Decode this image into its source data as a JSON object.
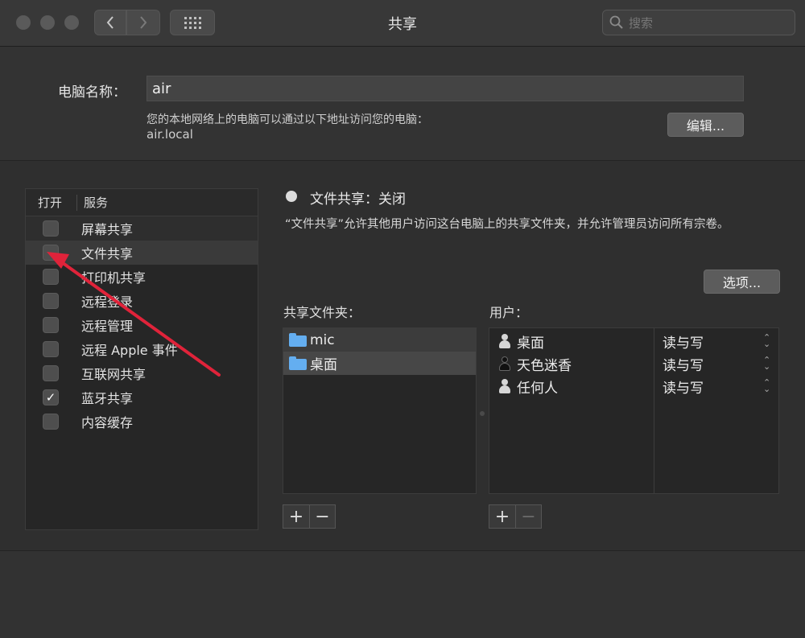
{
  "window": {
    "title": "共享",
    "search_placeholder": "搜索",
    "nav_icons": [
      "back-chevron-icon",
      "forward-chevron-icon",
      "grid-icon"
    ]
  },
  "computer_name": {
    "label": "电脑名称：",
    "value": "air",
    "description": "您的本地网络上的电脑可以通过以下地址访问您的电脑：",
    "local_address": "air.local",
    "edit_button": "编辑..."
  },
  "services": {
    "header_on": "打开",
    "header_service": "服务",
    "items": [
      {
        "label": "屏幕共享",
        "checked": false
      },
      {
        "label": "文件共享",
        "checked": false,
        "selected": true
      },
      {
        "label": "打印机共享",
        "checked": false
      },
      {
        "label": "远程登录",
        "checked": false
      },
      {
        "label": "远程管理",
        "checked": false
      },
      {
        "label": "远程 Apple 事件",
        "checked": false
      },
      {
        "label": "互联网共享",
        "checked": false
      },
      {
        "label": "蓝牙共享",
        "checked": true
      },
      {
        "label": "内容缓存",
        "checked": false
      }
    ]
  },
  "file_sharing": {
    "status": "文件共享：关闭",
    "description": "“文件共享”允许其他用户访问这台电脑上的共享文件夹，并允许管理员访问所有宗卷。",
    "options_button": "选项...",
    "folders_label": "共享文件夹：",
    "users_label": "用户：",
    "folders": [
      "mic",
      "桌面"
    ],
    "users": [
      {
        "name": "桌面",
        "permission": "读与写",
        "icon": "group-user-icon"
      },
      {
        "name": "天色迷香",
        "permission": "读与写",
        "icon": "single-user-icon"
      },
      {
        "name": "任何人",
        "permission": "读与写",
        "icon": "everyone-icon"
      }
    ],
    "add_symbol": "+",
    "remove_symbol": "−"
  },
  "colors": {
    "background": "#2f2f2f",
    "folder_blue": "#64aef0",
    "annotation_arrow": "#e0233a"
  }
}
